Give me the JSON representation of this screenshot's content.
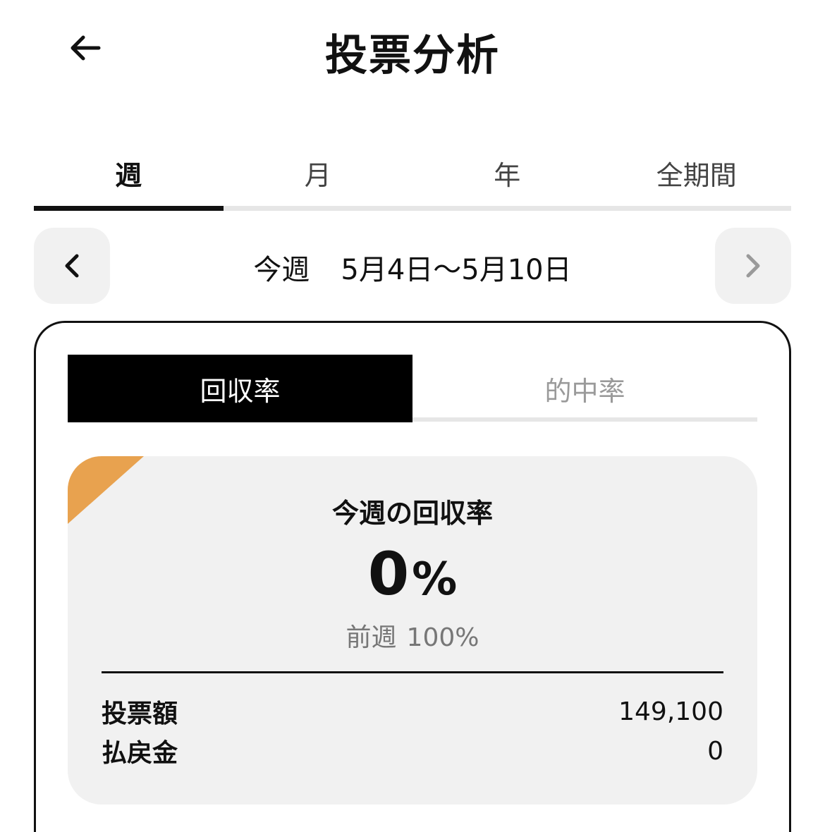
{
  "header": {
    "title": "投票分析",
    "back_icon": "arrow-left-icon"
  },
  "period_tabs": [
    {
      "label": "週",
      "active": true
    },
    {
      "label": "月",
      "active": false
    },
    {
      "label": "年",
      "active": false
    },
    {
      "label": "全期間",
      "active": false
    }
  ],
  "date_nav": {
    "label": "今週",
    "range": "5月4日〜5月10日",
    "prev_icon": "chevron-left-icon",
    "next_icon": "chevron-right-icon"
  },
  "metric_tabs": [
    {
      "label": "回収率",
      "active": true
    },
    {
      "label": "的中率",
      "active": false
    }
  ],
  "summary": {
    "title": "今週の回収率",
    "value": "0",
    "unit": "%",
    "previous_label": "前週",
    "previous_value": "100%",
    "rows": [
      {
        "label": "投票額",
        "value": "149,100"
      },
      {
        "label": "払戻金",
        "value": "0"
      }
    ]
  },
  "colors": {
    "accent": "#E8A24F",
    "active_tab": "#000000",
    "panel_bg": "#F1F1F1",
    "inactive_text": "#9A9A9A",
    "track": "#E6E6E6"
  }
}
